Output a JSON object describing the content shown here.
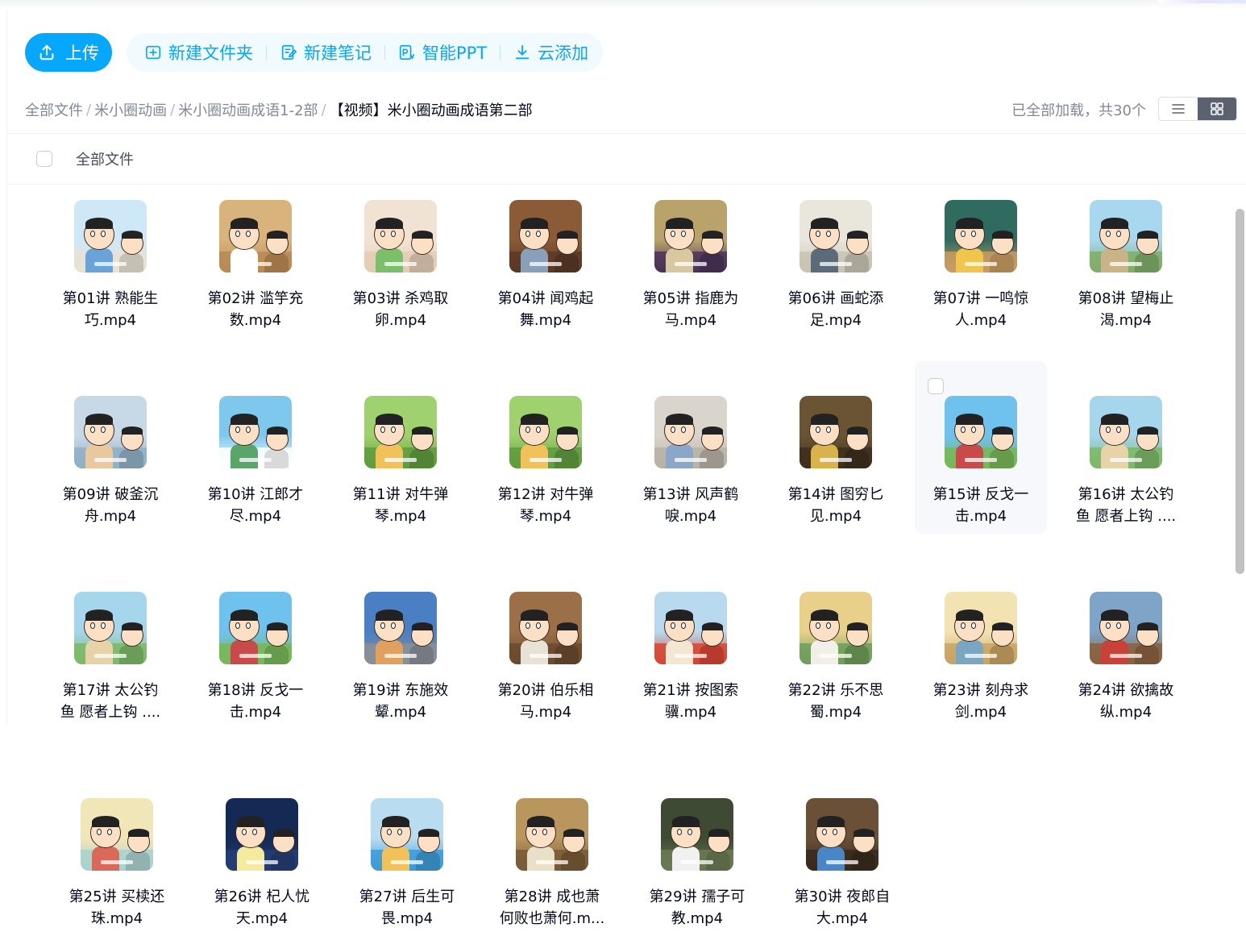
{
  "toolbar": {
    "upload_label": "上传",
    "actions": [
      {
        "label": "新建文件夹",
        "icon": "folder-plus-icon"
      },
      {
        "label": "新建笔记",
        "icon": "note-edit-icon"
      },
      {
        "label": "智能PPT",
        "icon": "ai-ppt-icon"
      },
      {
        "label": "云添加",
        "icon": "cloud-download-icon"
      }
    ]
  },
  "breadcrumb": {
    "items": [
      "全部文件",
      "米小圈动画",
      "米小圈动画成语1-2部"
    ],
    "current": "【视频】米小圈动画成语第二部"
  },
  "status": {
    "loaded_text": "已全部加载，共30个"
  },
  "view_toggle": {
    "options": [
      "list-view-icon",
      "grid-view-icon"
    ],
    "active": "grid"
  },
  "list_header": {
    "label": "全部文件"
  },
  "colors": {
    "accent": "#06a7ff",
    "accent_light": "#f0faff",
    "text": "#03081a",
    "muted": "#818999"
  },
  "files": [
    {
      "line1": "第01讲 熟能生",
      "line2": "巧.mp4",
      "palette": [
        "#cfe8f7",
        "#e9e2d4",
        "#6aa3d8"
      ]
    },
    {
      "line1": "第02讲 滥竽充",
      "line2": "数.mp4",
      "palette": [
        "#d9b37c",
        "#b98a54",
        "#ffffff"
      ]
    },
    {
      "line1": "第03讲 杀鸡取",
      "line2": "卵.mp4",
      "palette": [
        "#f1e3d3",
        "#e4cdb5",
        "#7bbf6a"
      ]
    },
    {
      "line1": "第04讲 闻鸡起",
      "line2": "舞.mp4",
      "palette": [
        "#8b5a36",
        "#5a3a24",
        "#8aa0b8"
      ]
    },
    {
      "line1": "第05讲 指鹿为",
      "line2": "马.mp4",
      "palette": [
        "#b9a36a",
        "#4a3258",
        "#d9c7a0"
      ]
    },
    {
      "line1": "第06讲 画蛇添",
      "line2": "足.mp4",
      "palette": [
        "#e9e6dc",
        "#c8c3b3",
        "#5b6b7a"
      ]
    },
    {
      "line1": "第07讲 一鸣惊",
      "line2": "人.mp4",
      "palette": [
        "#2f6b5e",
        "#c79c63",
        "#f0c54d"
      ]
    },
    {
      "line1": "第08讲 望梅止",
      "line2": "渴.mp4",
      "palette": [
        "#a8d7f0",
        "#7fae6a",
        "#c9b48a"
      ]
    },
    {
      "line1": "第09讲 破釜沉",
      "line2": "舟.mp4",
      "palette": [
        "#c7d8e6",
        "#8fb0c6",
        "#e8c89c"
      ]
    },
    {
      "line1": "第10讲 江郎才",
      "line2": "尽.mp4",
      "palette": [
        "#7ec8ee",
        "#ffffff",
        "#5aa56a"
      ]
    },
    {
      "line1": "第11讲 对牛弹",
      "line2": "琴.mp4",
      "palette": [
        "#9fd26e",
        "#5f9c3e",
        "#f1c15a"
      ]
    },
    {
      "line1": "第12讲 对牛弹",
      "line2": "琴.mp4",
      "palette": [
        "#9fd26e",
        "#5f9c3e",
        "#f1c15a"
      ]
    },
    {
      "line1": "第13讲 风声鹤",
      "line2": "唳.mp4",
      "palette": [
        "#d9d4cc",
        "#b9b1a6",
        "#8aa6c8"
      ]
    },
    {
      "line1": "第14讲 图穷匕",
      "line2": "见.mp4",
      "palette": [
        "#6a5434",
        "#3e2f1d",
        "#d8b24a"
      ]
    },
    {
      "line1": "第15讲 反戈一",
      "line2": "击.mp4",
      "palette": [
        "#6fc2ee",
        "#77b857",
        "#c94a4a"
      ]
    },
    {
      "line1": "第16讲 太公钓",
      "line2": "鱼 愿者上钩 ....",
      "palette": [
        "#a5d6ec",
        "#7cb968",
        "#e8d3a8"
      ]
    },
    {
      "line1": "第17讲 太公钓",
      "line2": "鱼 愿者上钩 ....",
      "palette": [
        "#a5d6ec",
        "#7cb968",
        "#e8d3a8"
      ]
    },
    {
      "line1": "第18讲 反戈一",
      "line2": "击.mp4",
      "palette": [
        "#6fc2ee",
        "#77b857",
        "#c94a4a"
      ]
    },
    {
      "line1": "第19讲 东施效",
      "line2": "颦.mp4",
      "palette": [
        "#4a7fc4",
        "#8a8f96",
        "#e0a060"
      ]
    },
    {
      "line1": "第20讲 伯乐相",
      "line2": "马.mp4",
      "palette": [
        "#9b7048",
        "#6b4a2e",
        "#e8e2d6"
      ]
    },
    {
      "line1": "第21讲 按图索",
      "line2": "骥.mp4",
      "palette": [
        "#b8d9ee",
        "#d64534",
        "#f4e7d2"
      ]
    },
    {
      "line1": "第22讲 乐不思",
      "line2": "蜀.mp4",
      "palette": [
        "#e8d08a",
        "#6f9e5a",
        "#f2efe8"
      ]
    },
    {
      "line1": "第23讲 刻舟求",
      "line2": "剑.mp4",
      "palette": [
        "#f3e3b2",
        "#c9a463",
        "#7aa6c2"
      ]
    },
    {
      "line1": "第24讲 欲擒故",
      "line2": "纵.mp4",
      "palette": [
        "#7ea4c8",
        "#8a6240",
        "#c9423a"
      ]
    },
    {
      "line1": "第25讲 买椟还",
      "line2": "珠.mp4",
      "palette": [
        "#f1e6b8",
        "#a9d2cf",
        "#d96a5a"
      ]
    },
    {
      "line1": "第26讲 杞人忧",
      "line2": "天.mp4",
      "palette": [
        "#142a55",
        "#243d73",
        "#f4eaa0"
      ]
    },
    {
      "line1": "第27讲 后生可",
      "line2": "畏.mp4",
      "palette": [
        "#b9dcf0",
        "#3d9bd8",
        "#f1c15a"
      ]
    },
    {
      "line1": "第28讲 成也萧",
      "line2": "何败也萧何.m...",
      "palette": [
        "#b9965e",
        "#7a5a36",
        "#eadfc8"
      ]
    },
    {
      "line1": "第29讲 孺子可",
      "line2": "教.mp4",
      "palette": [
        "#3f4a34",
        "#6a7a52",
        "#f1f1f1"
      ]
    },
    {
      "line1": "第30讲 夜郎自",
      "line2": "大.mp4",
      "palette": [
        "#6a5036",
        "#3a2a1c",
        "#4a86c6"
      ]
    }
  ]
}
